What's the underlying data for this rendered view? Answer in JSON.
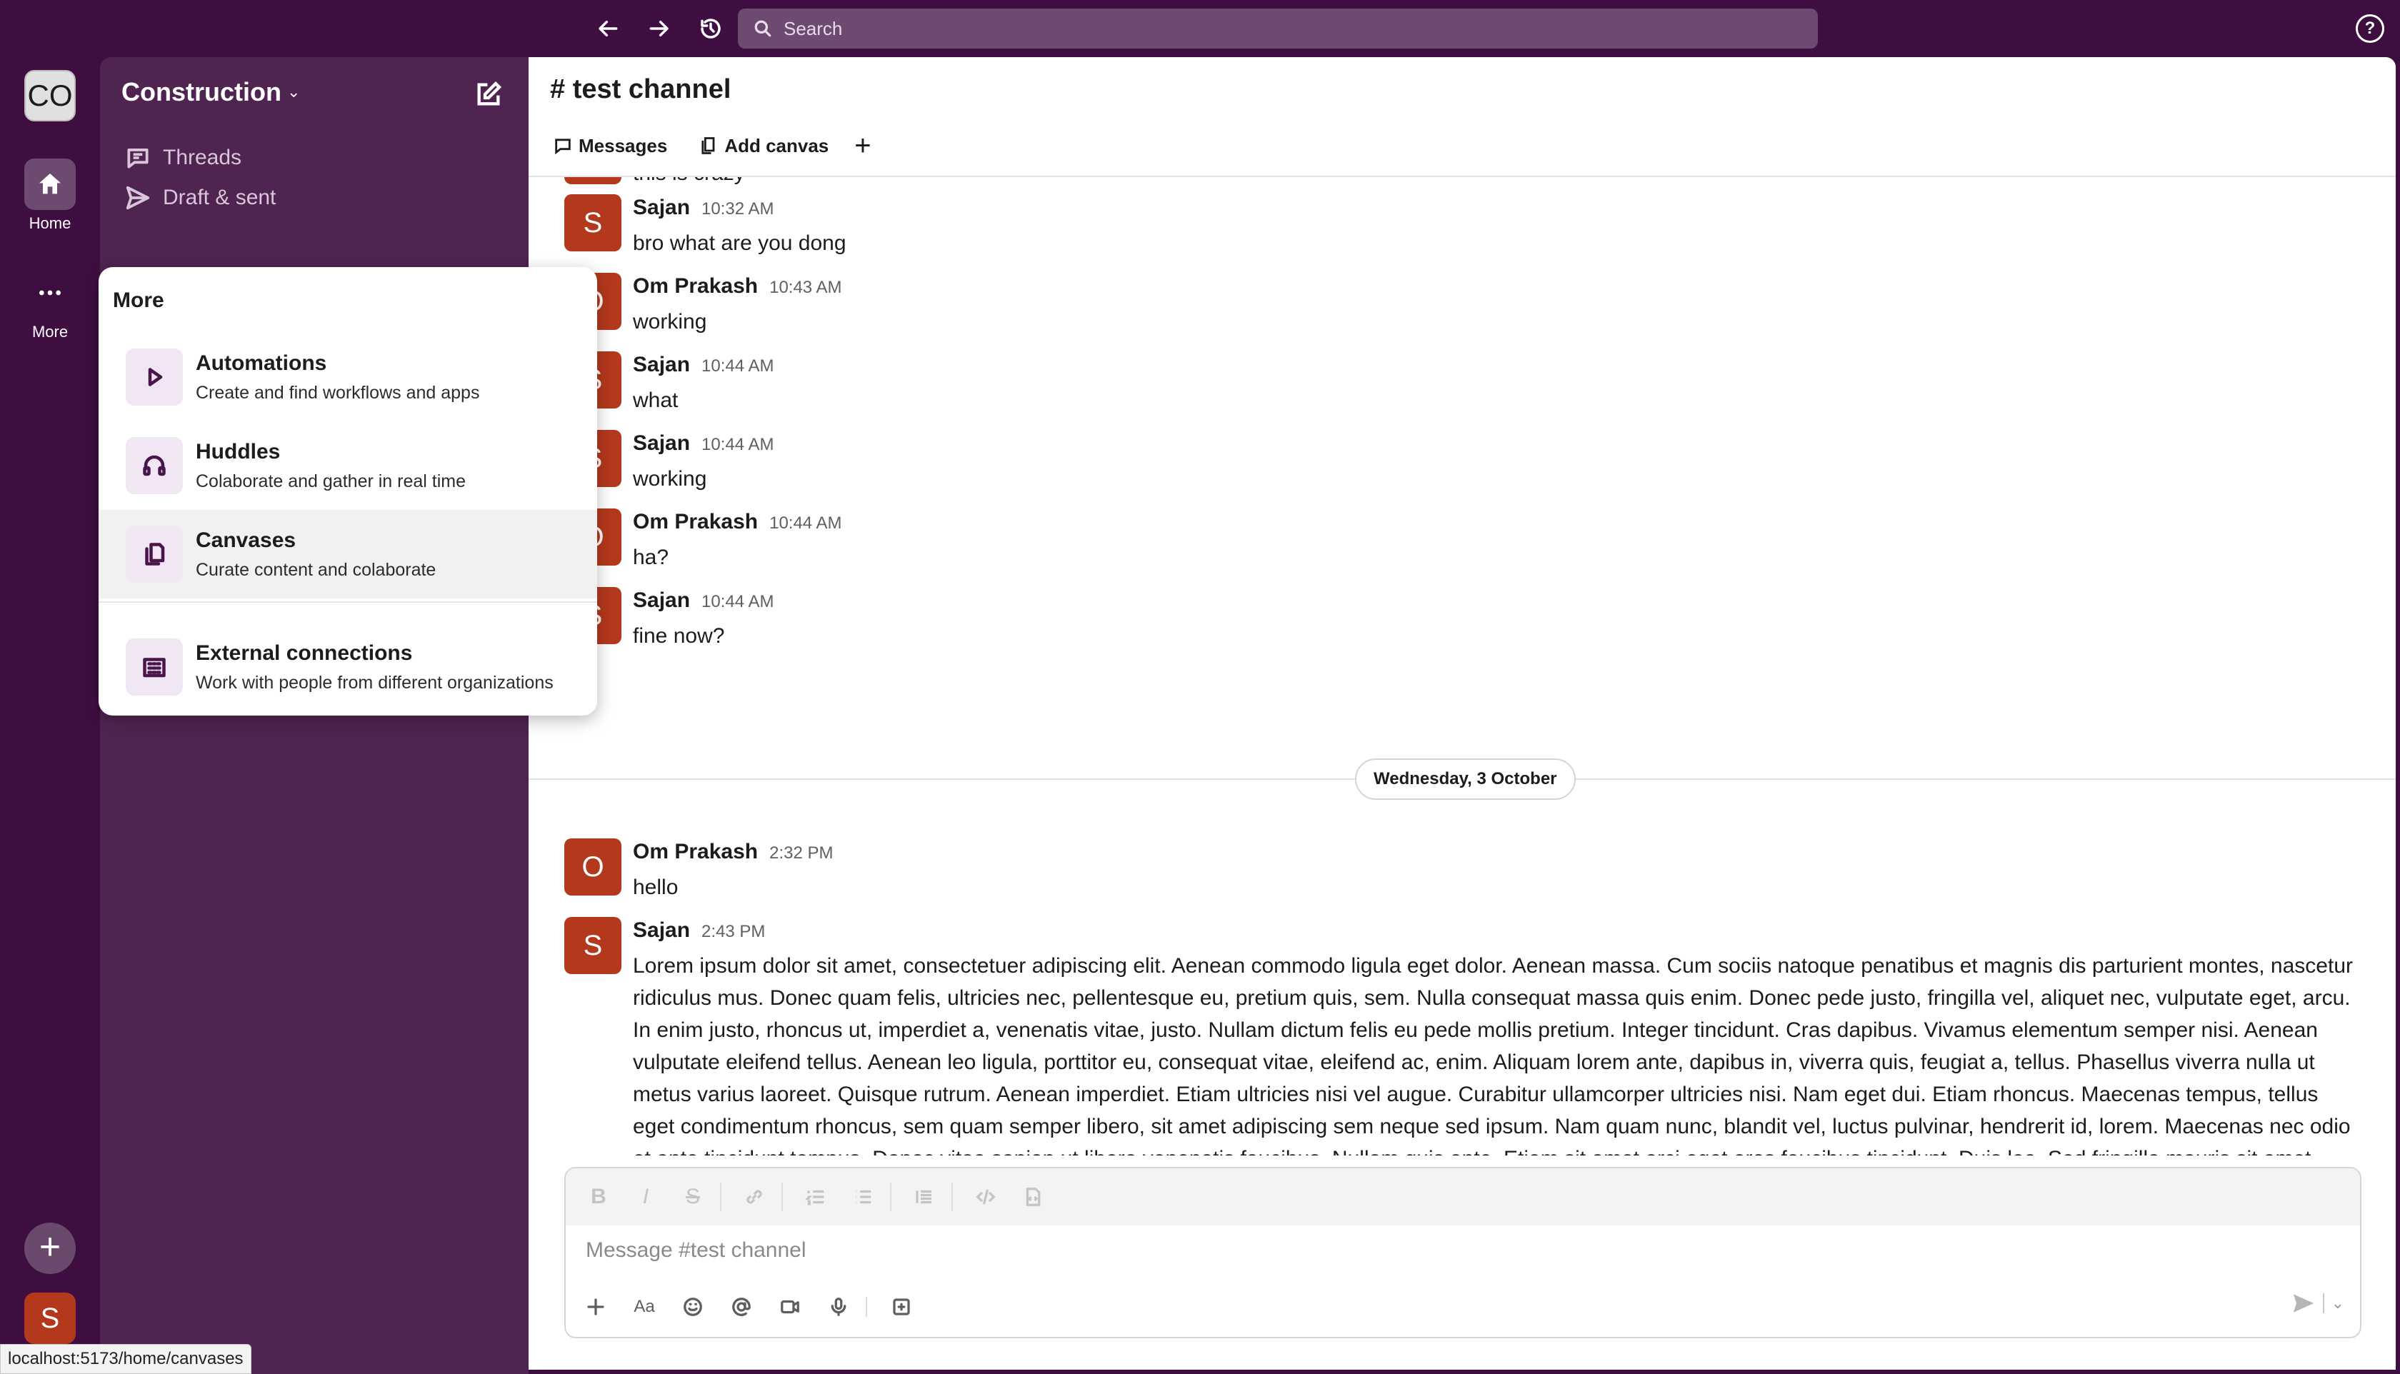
{
  "topbar": {
    "search_placeholder": "Search",
    "help_label": "?"
  },
  "rail": {
    "workspace_initials": "CO",
    "home_label": "Home",
    "more_label": "More",
    "add_label": "+",
    "user_initial": "S"
  },
  "sidebar": {
    "workspace_name": "Construction",
    "items": [
      {
        "label": "Threads",
        "icon": "threads-icon"
      },
      {
        "label": "Draft & sent",
        "icon": "send-icon"
      }
    ]
  },
  "channel": {
    "title": "# test channel",
    "tabs": [
      {
        "label": "Messages",
        "icon": "message-icon"
      },
      {
        "label": "Add canvas",
        "icon": "canvas-icon"
      }
    ],
    "add_tab": "+"
  },
  "messages": [
    {
      "initial": "S",
      "name": "Sajan",
      "time": "10:32 AM",
      "text": "bro what are you dong"
    },
    {
      "initial": "O",
      "name": "Om Prakash",
      "time": "10:43 AM",
      "text": "working"
    },
    {
      "initial": "S",
      "name": "Sajan",
      "time": "10:44 AM",
      "text": "what"
    },
    {
      "initial": "S",
      "name": "Sajan",
      "time": "10:44 AM",
      "text": "working"
    },
    {
      "initial": "O",
      "name": "Om Prakash",
      "time": "10:44 AM",
      "text": "ha?"
    },
    {
      "initial": "S",
      "name": "Sajan",
      "time": "10:44 AM",
      "text": "fine now?"
    },
    {
      "initial": "O",
      "name": "Om Prakash",
      "time": "2:32 PM",
      "text": "hello"
    },
    {
      "initial": "S",
      "name": "Sajan",
      "time": "2:43 PM",
      "text": "Lorem ipsum dolor sit amet, consectetuer adipiscing elit. Aenean commodo ligula eget dolor. Aenean massa. Cum sociis natoque penatibus et magnis dis parturient montes, nascetur ridiculus mus. Donec quam felis, ultricies nec, pellentesque eu, pretium quis, sem. Nulla consequat massa quis enim. Donec pede justo, fringilla vel, aliquet nec, vulputate eget, arcu. In enim justo, rhoncus ut, imperdiet a, venenatis vitae, justo. Nullam dictum felis eu pede mollis pretium. Integer tincidunt. Cras dapibus. Vivamus elementum semper nisi. Aenean vulputate eleifend tellus. Aenean leo ligula, porttitor eu, consequat vitae, eleifend ac, enim. Aliquam lorem ante, dapibus in, viverra quis, feugiat a, tellus. Phasellus viverra nulla ut metus varius laoreet. Quisque rutrum. Aenean imperdiet. Etiam ultricies nisi vel augue. Curabitur ullamcorper ultricies nisi. Nam eget dui. Etiam rhoncus. Maecenas tempus, tellus eget condimentum rhoncus, sem quam semper libero, sit amet adipiscing sem neque sed ipsum. Nam quam nunc, blandit vel, luctus pulvinar, hendrerit id, lorem. Maecenas nec odio et ante tincidunt tempus. Donec vitae sapien ut libero venenatis faucibus. Nullam quis ante. Etiam sit amet orci eget eros faucibus tincidunt. Duis leo. Sed fringilla mauris sit amet nibh. Donec sodales sagittis magna. Sed consequat, leo eget bibendum sodales, augue velit cursus nunc,"
    }
  ],
  "partial_message_text": "this is crazy",
  "date_divider": "Wednesday, 3 October",
  "composer": {
    "placeholder": "Message #test channel"
  },
  "more_menu": {
    "title": "More",
    "items": [
      {
        "name": "Automations",
        "desc": "Create and find workflows and apps",
        "icon": "play-icon"
      },
      {
        "name": "Huddles",
        "desc": "Colaborate and gather in real time",
        "icon": "headphones-icon"
      },
      {
        "name": "Canvases",
        "desc": "Curate content and colaborate",
        "icon": "canvas-icon"
      },
      {
        "name": "External connections",
        "desc": "Work with people from different organizations",
        "icon": "building-icon"
      }
    ]
  },
  "status_url": "localhost:5173/home/canvases",
  "colors": {
    "aubergine": "#3f0e40",
    "sidebar": "#4f2450",
    "avatar": "#b4391c"
  }
}
